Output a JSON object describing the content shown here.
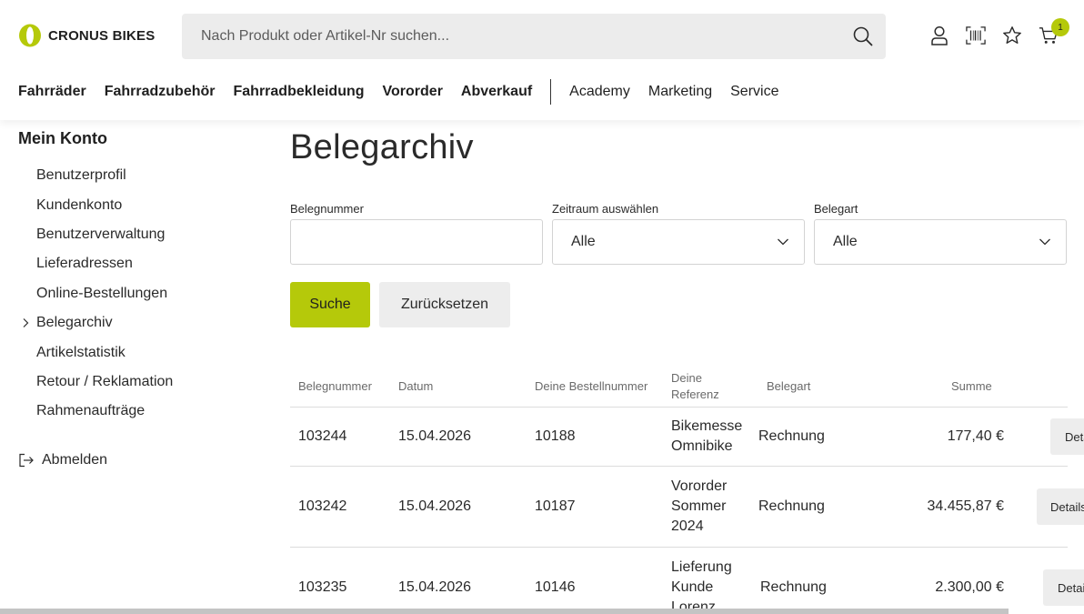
{
  "brand": {
    "name": "CRONUS BIKES",
    "accent": "#b5c90a"
  },
  "search": {
    "placeholder": "Nach Produkt oder Artikel-Nr suchen..."
  },
  "header_icons": {
    "cart_count": "1"
  },
  "nav": {
    "main": [
      "Fahrräder",
      "Fahrradzubehör",
      "Fahrradbekleidung",
      "Vororder",
      "Abverkauf"
    ],
    "secondary": [
      "Academy",
      "Marketing",
      "Service"
    ]
  },
  "sidebar": {
    "title": "Mein Konto",
    "items": [
      {
        "label": "Benutzerprofil"
      },
      {
        "label": "Kundenkonto"
      },
      {
        "label": "Benutzerverwaltung"
      },
      {
        "label": "Lieferadressen"
      },
      {
        "label": "Online-Bestellungen"
      },
      {
        "label": "Belegarchiv",
        "active": true
      },
      {
        "label": "Artikelstatistik"
      },
      {
        "label": "Retour / Reklamation"
      },
      {
        "label": "Rahmenaufträge"
      }
    ],
    "logout": "Abmelden"
  },
  "page": {
    "title": "Belegarchiv",
    "filters": {
      "number_label": "Belegnummer",
      "number_value": "",
      "period_label": "Zeitraum auswählen",
      "period_value": "Alle",
      "type_label": "Belegart",
      "type_value": "Alle"
    },
    "search_button": "Suche",
    "reset_button": "Zurücksetzen"
  },
  "table": {
    "headers": {
      "number": "Belegnummer",
      "date": "Datum",
      "order": "Deine Bestellnummer",
      "ref_line1": "Deine",
      "ref_line2": "Referenz",
      "type": "Belegart",
      "sum": "Summe"
    },
    "rows": [
      {
        "number": "103244",
        "date": "15.04.2026",
        "order": "10188",
        "reference": "Bikemesse Omnibike",
        "type": "Rechnung",
        "sum": "177,40 €",
        "detail": "Details"
      },
      {
        "number": "103242",
        "date": "15.04.2026",
        "order": "10187",
        "reference": "Vororder Sommer 2024",
        "type": "Rechnung",
        "sum": "34.455,87 €",
        "detail": "Details"
      },
      {
        "number": "103235",
        "date": "15.04.2026",
        "order": "10146",
        "reference": "Lieferung Kunde Lorenz",
        "type": "Rechnung",
        "sum": "2.300,00 €",
        "detail": "Details"
      }
    ]
  }
}
